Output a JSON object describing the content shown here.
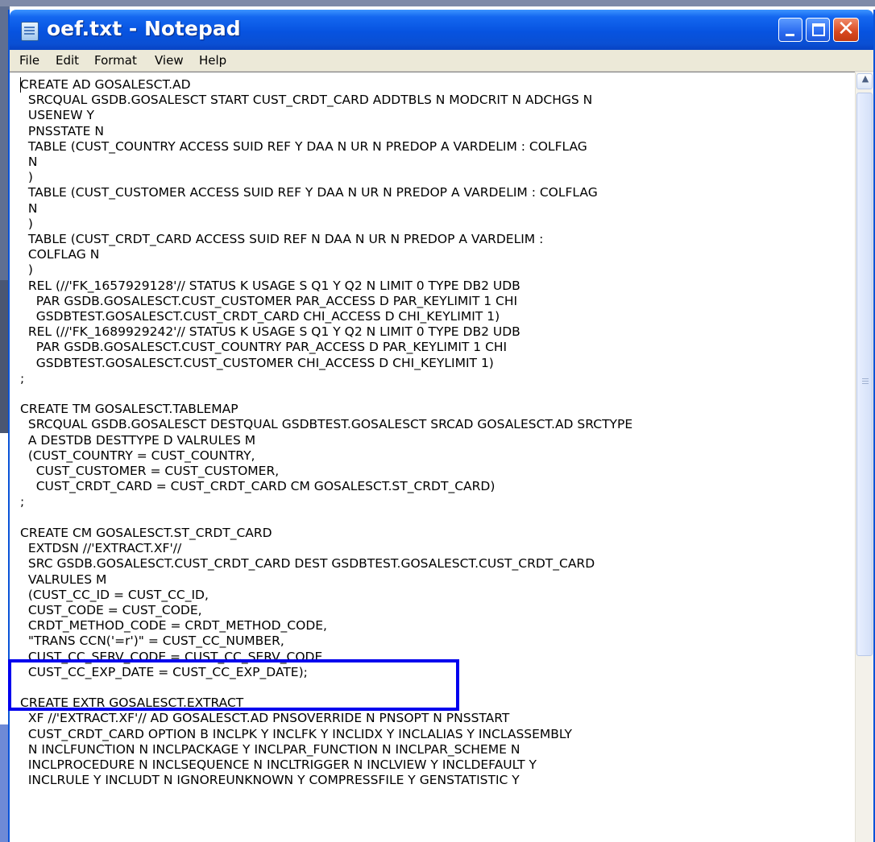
{
  "window": {
    "title": "oef.txt - Notepad"
  },
  "menu": [
    "File",
    "Edit",
    "Format",
    "View",
    "Help"
  ],
  "controls": {
    "close_glyph": "✕",
    "scroll_up_glyph": "▲"
  },
  "colors": {
    "titlebar": "#0753e0",
    "highlight_box": "#0000ee"
  },
  "document": {
    "lines": [
      "CREATE AD GOSALESCT.AD",
      "  SRCQUAL GSDB.GOSALESCT START CUST_CRDT_CARD ADDTBLS N MODCRIT N ADCHGS N",
      "  USENEW Y",
      "  PNSSTATE N",
      "  TABLE (CUST_COUNTRY ACCESS SUID REF Y DAA N UR N PREDOP A VARDELIM : COLFLAG",
      "  N",
      "  )",
      "  TABLE (CUST_CUSTOMER ACCESS SUID REF Y DAA N UR N PREDOP A VARDELIM : COLFLAG",
      "  N",
      "  )",
      "  TABLE (CUST_CRDT_CARD ACCESS SUID REF N DAA N UR N PREDOP A VARDELIM :",
      "  COLFLAG N",
      "  )",
      "  REL (//'FK_1657929128'// STATUS K USAGE S Q1 Y Q2 N LIMIT 0 TYPE DB2 UDB",
      "    PAR GSDB.GOSALESCT.CUST_CUSTOMER PAR_ACCESS D PAR_KEYLIMIT 1 CHI",
      "    GSDBTEST.GOSALESCT.CUST_CRDT_CARD CHI_ACCESS D CHI_KEYLIMIT 1)",
      "  REL (//'FK_1689929242'// STATUS K USAGE S Q1 Y Q2 N LIMIT 0 TYPE DB2 UDB",
      "    PAR GSDB.GOSALESCT.CUST_COUNTRY PAR_ACCESS D PAR_KEYLIMIT 1 CHI",
      "    GSDBTEST.GOSALESCT.CUST_CUSTOMER CHI_ACCESS D CHI_KEYLIMIT 1)",
      ";",
      "",
      "CREATE TM GOSALESCT.TABLEMAP",
      "  SRCQUAL GSDB.GOSALESCT DESTQUAL GSDBTEST.GOSALESCT SRCAD GOSALESCT.AD SRCTYPE",
      "  A DESTDB DESTTYPE D VALRULES M",
      "  (CUST_COUNTRY = CUST_COUNTRY,",
      "    CUST_CUSTOMER = CUST_CUSTOMER,",
      "    CUST_CRDT_CARD = CUST_CRDT_CARD CM GOSALESCT.ST_CRDT_CARD)",
      ";",
      "",
      "CREATE CM GOSALESCT.ST_CRDT_CARD",
      "  EXTDSN //'EXTRACT.XF'//",
      "  SRC GSDB.GOSALESCT.CUST_CRDT_CARD DEST GSDBTEST.GOSALESCT.CUST_CRDT_CARD",
      "  VALRULES M",
      "  (CUST_CC_ID = CUST_CC_ID,",
      "  CUST_CODE = CUST_CODE,",
      "  CRDT_METHOD_CODE = CRDT_METHOD_CODE,",
      "  \"TRANS CCN('=r')\" = CUST_CC_NUMBER,",
      "  CUST_CC_SERV_CODE = CUST_CC_SERV_CODE,",
      "  CUST_CC_EXP_DATE = CUST_CC_EXP_DATE);",
      "",
      "CREATE EXTR GOSALESCT.EXTRACT",
      "  XF //'EXTRACT.XF'// AD GOSALESCT.AD PNSOVERRIDE N PNSOPT N PNSSTART",
      "  CUST_CRDT_CARD OPTION B INCLPK Y INCLFK Y INCLIDX Y INCLALIAS Y INCLASSEMBLY",
      "  N INCLFUNCTION N INCLPACKAGE Y INCLPAR_FUNCTION N INCLPAR_SCHEME N",
      "  INCLPROCEDURE N INCLSEQUENCE N INCLTRIGGER N INCLVIEW Y INCLDEFAULT Y",
      "  INCLRULE Y INCLUDT N IGNOREUNKNOWN Y COMPRESSFILE Y GENSTATISTIC Y"
    ]
  }
}
